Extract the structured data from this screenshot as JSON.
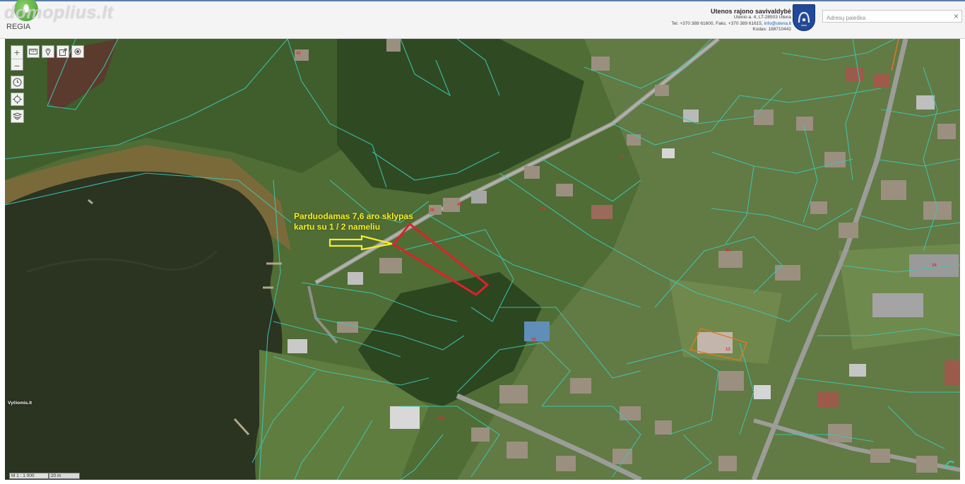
{
  "header": {
    "watermark": "domoplius.lt",
    "brand": "REGIA",
    "org_name": "Utenos rajono savivaldybė",
    "org_address": "Utenio a. 4, LT-28503 Utena",
    "org_phone": "Tel. +370 389 61600, Faks. +370 389 61615,",
    "org_email": "info@utena.lt",
    "org_code": "Kodas: 188710442",
    "search_placeholder": "Adresų paieška",
    "search_clear": "×"
  },
  "map": {
    "annotation_line1": "Parduodamas 7,6 aro sklypas",
    "annotation_line2": "kartu su 1 / 2 nameliu",
    "credit": "Vyčiomis.lt",
    "scale_label": "M 1 : 1 000",
    "scale_dist": "20 m",
    "colors": {
      "parcel_lines": "#3cc8b4",
      "plot_outline": "#e0202a",
      "annotation": "#f4ee2a",
      "water": "#2b3321"
    }
  },
  "controls": {
    "zoom_in": "+",
    "zoom_out": "−"
  }
}
